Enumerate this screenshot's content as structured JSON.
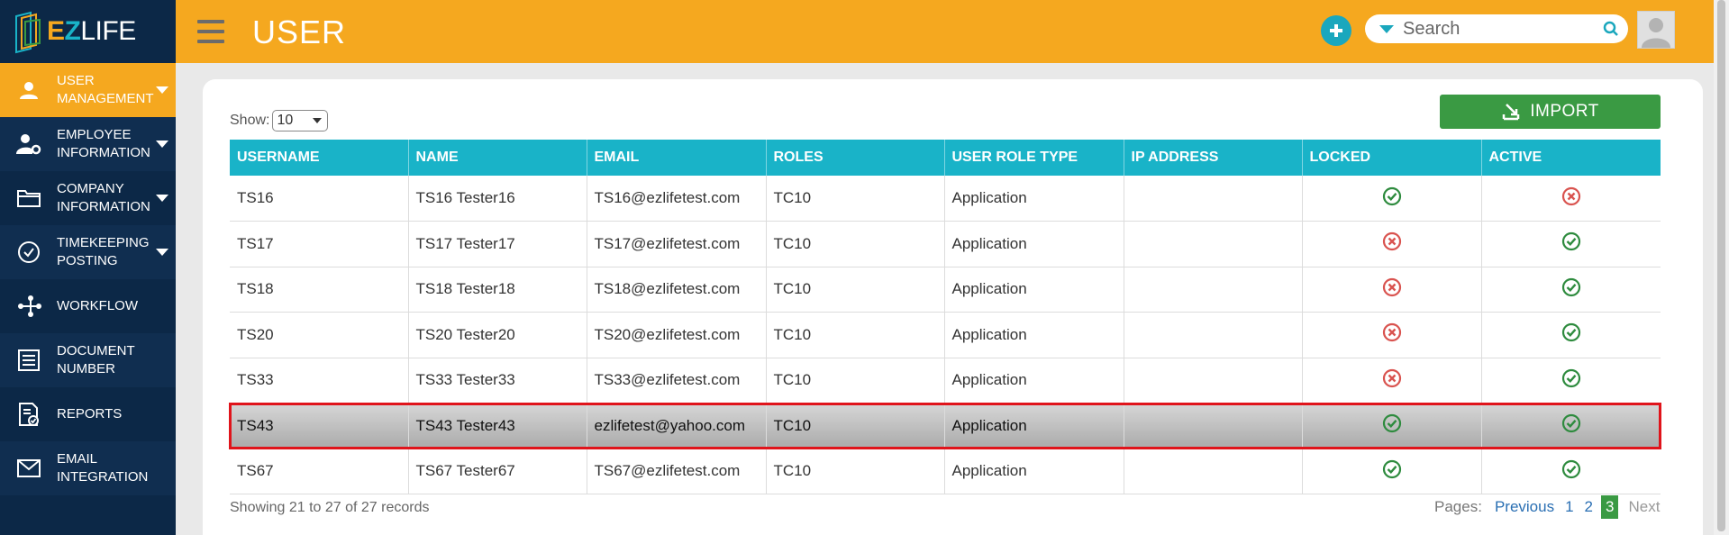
{
  "app": {
    "logo_e": "E",
    "logo_z": "Z",
    "logo_rest": "LIFE"
  },
  "header": {
    "title": "USER",
    "search_placeholder": "Search"
  },
  "colors": {
    "brand_orange": "#f5a81f",
    "sidebar_navy": "#0c2847",
    "teal": "#19b3c8",
    "green": "#3a9a43",
    "red": "#e0141b"
  },
  "sidebar": {
    "items": [
      {
        "label": "USER MANAGEMENT",
        "icon": "user-icon",
        "active": true,
        "has_caret": true
      },
      {
        "label": "EMPLOYEE INFORMATION",
        "icon": "user-gear-icon",
        "active": false,
        "has_caret": true
      },
      {
        "label": "COMPANY INFORMATION",
        "icon": "folder-icon",
        "active": false,
        "has_caret": true
      },
      {
        "label": "TIMEKEEPING POSTING",
        "icon": "check-circle-icon",
        "active": false,
        "has_caret": true
      },
      {
        "label": "WORKFLOW",
        "icon": "workflow-icon",
        "active": false,
        "has_caret": false
      },
      {
        "label": "DOCUMENT NUMBER",
        "icon": "document-list-icon",
        "active": false,
        "has_caret": false
      },
      {
        "label": "REPORTS",
        "icon": "report-icon",
        "active": false,
        "has_caret": false
      },
      {
        "label": "EMAIL INTEGRATION",
        "icon": "mail-icon",
        "active": false,
        "has_caret": false
      }
    ]
  },
  "toolbar": {
    "show_label": "Show:",
    "show_value": "10",
    "import_label": "IMPORT"
  },
  "table": {
    "columns": [
      "USERNAME",
      "NAME",
      "EMAIL",
      "ROLES",
      "USER ROLE TYPE",
      "IP ADDRESS",
      "LOCKED",
      "ACTIVE"
    ],
    "rows": [
      {
        "username": "TS16",
        "name": "TS16 Tester16",
        "email": "TS16@ezlifetest.com",
        "roles": "TC10",
        "role_type": "Application",
        "ip": "",
        "locked": true,
        "active": false,
        "selected": false
      },
      {
        "username": "TS17",
        "name": "TS17 Tester17",
        "email": "TS17@ezlifetest.com",
        "roles": "TC10",
        "role_type": "Application",
        "ip": "",
        "locked": false,
        "active": true,
        "selected": false
      },
      {
        "username": "TS18",
        "name": "TS18 Tester18",
        "email": "TS18@ezlifetest.com",
        "roles": "TC10",
        "role_type": "Application",
        "ip": "",
        "locked": false,
        "active": true,
        "selected": false
      },
      {
        "username": "TS20",
        "name": "TS20 Tester20",
        "email": "TS20@ezlifetest.com",
        "roles": "TC10",
        "role_type": "Application",
        "ip": "",
        "locked": false,
        "active": true,
        "selected": false
      },
      {
        "username": "TS33",
        "name": "TS33 Tester33",
        "email": "TS33@ezlifetest.com",
        "roles": "TC10",
        "role_type": "Application",
        "ip": "",
        "locked": false,
        "active": true,
        "selected": false
      },
      {
        "username": "TS43",
        "name": "TS43 Tester43",
        "email": "ezlifetest@yahoo.com",
        "roles": "TC10",
        "role_type": "Application",
        "ip": "",
        "locked": true,
        "active": true,
        "selected": true
      },
      {
        "username": "TS67",
        "name": "TS67 Tester67",
        "email": "TS67@ezlifetest.com",
        "roles": "TC10",
        "role_type": "Application",
        "ip": "",
        "locked": true,
        "active": true,
        "selected": false
      }
    ]
  },
  "footer": {
    "showing": "Showing 21 to 27 of 27 records",
    "pages_label": "Pages:",
    "previous": "Previous",
    "pages": [
      "1",
      "2",
      "3"
    ],
    "current_page": "3",
    "next": "Next"
  }
}
